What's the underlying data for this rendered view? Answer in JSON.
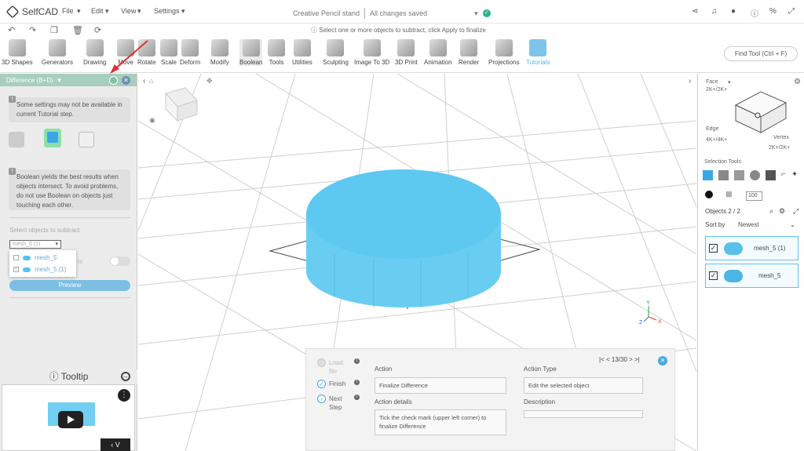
{
  "app": {
    "name": "SelfCAD"
  },
  "menu": [
    "File",
    "Edit",
    "View",
    "Settings"
  ],
  "document": {
    "title": "Creative Pencil stand",
    "status": "All changes saved"
  },
  "hint": "Select one or more objects to subtract, click Apply to finalize",
  "toolbar": [
    {
      "label": "3D Shapes"
    },
    {
      "label": "Generators"
    },
    {
      "label": "Drawing"
    },
    {
      "label": "Move"
    },
    {
      "label": "Rotate"
    },
    {
      "label": "Scale"
    },
    {
      "label": "Deform"
    },
    {
      "label": "Modify"
    },
    {
      "label": "Boolean"
    },
    {
      "label": "Tools"
    },
    {
      "label": "Utilities"
    },
    {
      "label": "Sculpting"
    },
    {
      "label": "Image To 3D"
    },
    {
      "label": "3D Print"
    },
    {
      "label": "Animation"
    },
    {
      "label": "Render"
    },
    {
      "label": "Projections"
    },
    {
      "label": "Tutorials"
    }
  ],
  "find_tool": "Find Tool (Ctrl + F)",
  "left_panel": {
    "title": "Difference (B+D)",
    "note1": "Some settings may not be available in current Tutorial step.",
    "note2": "Boolean yields the best results when objects intersect. To avoid problems, do not use Boolean on objects just touching each other.",
    "select_label": "Select objects to subtract",
    "dropdown_value": "mesh_5 (1)",
    "dropdown_options": [
      "mesh_5",
      "mesh_5 (1)"
    ],
    "hidden_label": "ts",
    "preview_label": "Preview",
    "tooltip_title": "Tooltip"
  },
  "right_panel": {
    "face": "Face",
    "face_keys": "2K+/2K+",
    "edge": "Edge",
    "edge_keys": "4K+/4K+",
    "vertex": "Vertex",
    "vertex_keys": "2K+/2K+",
    "selection_tools": "Selection Tools",
    "opacity": "100",
    "objects_label": "Objects 2 / 2",
    "sort_label": "Sort by",
    "sort_value": "Newest",
    "objects": [
      {
        "name": "mesh_5 (1)"
      },
      {
        "name": "mesh_5"
      }
    ]
  },
  "tutorial": {
    "steps": [
      "Load file",
      "Finish",
      "Next Step"
    ],
    "nav": "|< < 13/30 > >|",
    "action_label": "Action",
    "action_value": "Finalize Difference",
    "details_label": "Action details",
    "details_value": "Tick the check mark (upper left corner) to finalize Difference",
    "type_label": "Action Type",
    "type_value": "Edit the selected object",
    "desc_label": "Description"
  },
  "colors": {
    "accent": "#59c1ea",
    "header": "#a7cfbc",
    "status_ok": "#27b58a"
  }
}
